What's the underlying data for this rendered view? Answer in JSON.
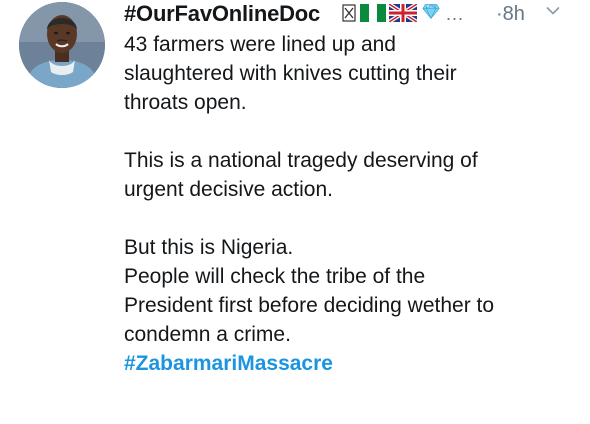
{
  "tweet": {
    "author": {
      "display_name": "#OurFavOnlineDoc",
      "badges": [
        "framed-x-icon",
        "nigeria-flag-icon",
        "uk-flag-icon",
        "gem-icon"
      ],
      "more": "..."
    },
    "time": "8h",
    "time_separator": "·",
    "menu_icon": "chevron-down-icon",
    "text": {
      "p1": [
        "43 farmers were lined up and",
        "slaughtered with knives cutting their",
        "throats open."
      ],
      "p2": [
        "This is a national tragedy deserving of",
        "urgent decisive action."
      ],
      "p3": [
        "But this is Nigeria.",
        "People will check the tribe of the",
        "President first before deciding wether to",
        "condemn a crime."
      ],
      "hashtag": "#ZabarmariMassacre"
    },
    "colors": {
      "hashtag": "#1b95e0",
      "meta": "#657786",
      "text": "#14171a"
    }
  }
}
